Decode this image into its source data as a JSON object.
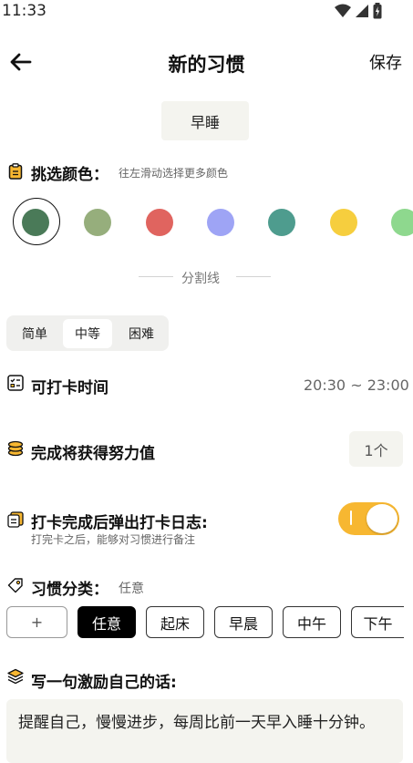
{
  "status_bar": {
    "time": "11:33"
  },
  "header": {
    "title": "新的习惯",
    "save_label": "保存"
  },
  "habit_name": "早睡",
  "colors": {
    "label": "挑选颜色：",
    "hint": "往左滑动选择更多颜色",
    "swatches": [
      "#4a7a58",
      "#96ae7c",
      "#e0645f",
      "#9ea4f5",
      "#4e9c8e",
      "#f6ce3e",
      "#8ed88e"
    ],
    "selected_index": 0
  },
  "divider": {
    "text": "分割线"
  },
  "difficulty": {
    "options": [
      "简单",
      "中等",
      "困难"
    ],
    "selected": "中等"
  },
  "checkin_time": {
    "label": "可打卡时间",
    "value": "20:30 ~ 23:00"
  },
  "effort": {
    "label": "完成将获得努力值",
    "value": "1个"
  },
  "log_popup": {
    "label": "打卡完成后弹出打卡日志:",
    "hint": "打完卡之后，能够对习惯进行备注",
    "enabled": true
  },
  "category": {
    "label": "习惯分类：",
    "current": "任意",
    "add_label": "+",
    "chips": [
      "任意",
      "起床",
      "早晨",
      "中午",
      "下午"
    ],
    "selected": "任意"
  },
  "motto": {
    "label": "写一句激励自己的话:",
    "text": "提醒自己，慢慢进步，每周比前一天早入睡十分钟。"
  },
  "accent_color": "#f7b731"
}
